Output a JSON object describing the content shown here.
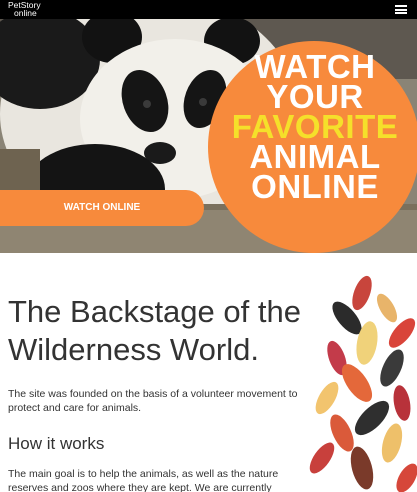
{
  "header": {
    "logo_line1": "PetStory",
    "logo_line2": "online",
    "menu_icon": "hamburger-menu-icon"
  },
  "hero": {
    "headline_line1": "WATCH",
    "headline_line2": "YOUR",
    "headline_line3": "FAVORITE",
    "headline_line4": "ANIMAL",
    "headline_line5": "ONLINE",
    "button_label": "WATCH ONLINE",
    "accent_color": "#f78a3c",
    "highlight_color": "#f5e02a"
  },
  "main": {
    "title": "The Backstage of the Wilderness World.",
    "intro": "The site was founded on the basis of a volunteer movement to protect and care for animals.",
    "section_heading": "How it works",
    "section_text": "The main goal is to help the animals, as well as the nature reserves and zoos where they are kept. We are currently"
  }
}
